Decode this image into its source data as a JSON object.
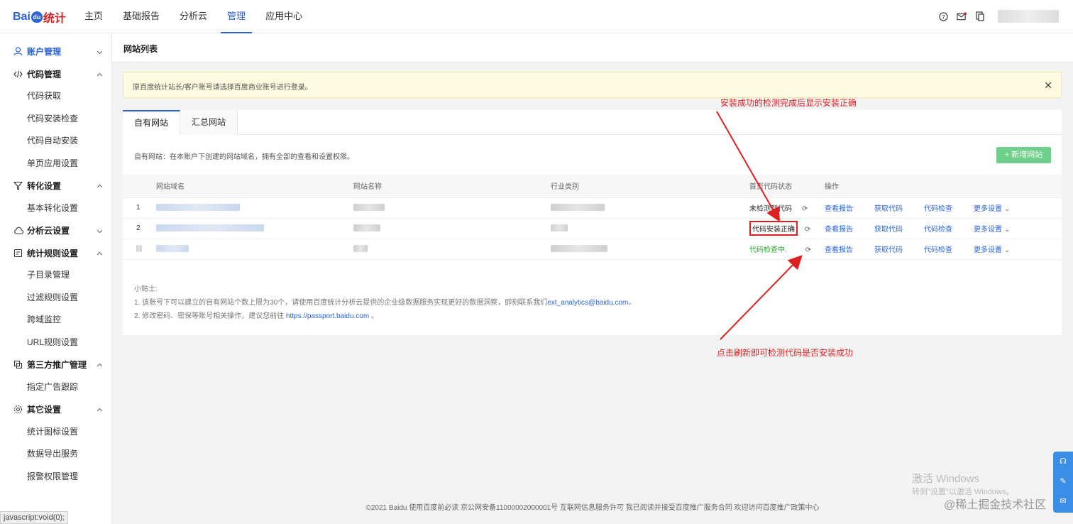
{
  "brand": {
    "part1": "Bai",
    "paw": "du",
    "part2": "统计"
  },
  "nav": [
    "主页",
    "基础报告",
    "分析云",
    "管理",
    "应用中心"
  ],
  "nav_active": "管理",
  "sidebar": {
    "groups": [
      {
        "label": "账户管理",
        "icon": "user-icon",
        "items": []
      },
      {
        "label": "代码管理",
        "icon": "code-icon",
        "items": [
          "代码获取",
          "代码安装检查",
          "代码自动安装",
          "单页应用设置"
        ]
      },
      {
        "label": "转化设置",
        "icon": "funnel-icon",
        "items": [
          "基本转化设置"
        ]
      },
      {
        "label": "分析云设置",
        "icon": "cloud-icon",
        "items": []
      },
      {
        "label": "统计规则设置",
        "icon": "rules-icon",
        "items": [
          "子目录管理",
          "过滤规则设置",
          "跨域监控",
          "URL规则设置"
        ]
      },
      {
        "label": "第三方推广管理",
        "icon": "third-party-icon",
        "items": [
          "指定广告跟踪"
        ]
      },
      {
        "label": "其它设置",
        "icon": "gear-icon",
        "items": [
          "统计图标设置",
          "数据导出服务",
          "报警权限管理"
        ]
      }
    ]
  },
  "status_tip": "javascript:void(0);",
  "page_title": "网站列表",
  "notice": "原百度统计站长/客户账号请选择百度商业账号进行登录。",
  "tabs": [
    "自有网站",
    "汇总网站"
  ],
  "description": "自有网站：在本账户下创建的网站域名，拥有全部的查看和设置权限。",
  "add_button": "+ 新增网站",
  "table": {
    "headers": [
      "网站域名",
      "网站名称",
      "行业类别",
      "首页代码状态",
      "操作"
    ],
    "rows": [
      {
        "index": "1",
        "status": "未检测到代码",
        "status_type": "none"
      },
      {
        "index": "2",
        "status": "代码安装正确",
        "status_type": "ok"
      },
      {
        "index": "",
        "status": "代码检查中.",
        "status_type": "checking"
      }
    ],
    "actions": [
      "查看报告",
      "获取代码",
      "代码检查",
      "更多设置"
    ]
  },
  "tips": {
    "title": "小贴士:",
    "line1_prefix": "1. 该账号下可以建立的自有网站个数上限为30个，请使用百度统计分析云提供的企业级数据服务实现更好的数据洞察，即刻联系我们",
    "line1_link": "ext_analytics@baidu.com",
    "line1_suffix": "。",
    "line2_prefix": "2. 修改密码、密保等账号相关操作，建议您前往 ",
    "line2_link": "https://passport.baidu.com",
    "line2_suffix": " 。"
  },
  "footer": "©2021 Baidu 使用百度前必读 京公网安备11000002000001号 互联网信息服务许可 我已阅读并接受百度推广服务合同 欢迎访问百度推广政策中心",
  "annotations": {
    "top": "安装成功的检测完成后显示安装正确",
    "bottom": "点击刷新即可检测代码是否安装成功"
  },
  "watermarks": {
    "activate": "激活 Windows",
    "activate_sub": "转到\"设置\"以激活 Windows。",
    "site": "@稀土掘金技术社区"
  },
  "colors": {
    "brand_blue": "#2b63d9",
    "add_green": "#6ed08a",
    "annotation_red": "#e02020",
    "checking_green": "#2aa52e"
  }
}
